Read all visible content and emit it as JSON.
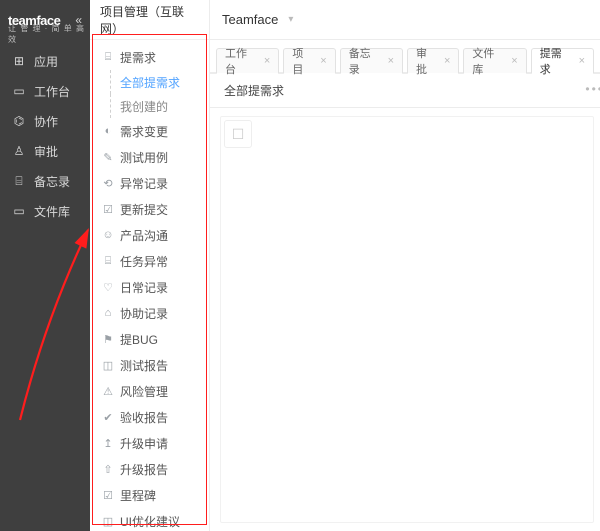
{
  "brand": {
    "name": "teamface",
    "tagline": "让 管 理 · 简 单 高 效",
    "collapse_glyph": "«"
  },
  "sidebar": {
    "items": [
      {
        "icon": "⊞",
        "label": "应用"
      },
      {
        "icon": "▭",
        "label": "工作台"
      },
      {
        "icon": "⌬",
        "label": "协作"
      },
      {
        "icon": "♙",
        "label": "审批"
      },
      {
        "icon": "⌸",
        "label": "备忘录"
      },
      {
        "icon": "▭",
        "label": "文件库"
      }
    ]
  },
  "panel": {
    "title": "项目管理（互联网）",
    "tree": {
      "root": {
        "icon": "⌸",
        "label": "提需求"
      },
      "subs": [
        {
          "label": "全部提需求",
          "active": true
        },
        {
          "label": "我创建的",
          "active": false
        }
      ]
    },
    "items": [
      {
        "icon": "◐",
        "label": "需求变更"
      },
      {
        "icon": "✎",
        "label": "测试用例"
      },
      {
        "icon": "⟲",
        "label": "异常记录"
      },
      {
        "icon": "☑",
        "label": "更新提交"
      },
      {
        "icon": "☺",
        "label": "产品沟通"
      },
      {
        "icon": "⌸",
        "label": "任务异常"
      },
      {
        "icon": "♡",
        "label": "日常记录"
      },
      {
        "icon": "⌂",
        "label": "协助记录"
      },
      {
        "icon": "⚑",
        "label": "提BUG"
      },
      {
        "icon": "◫",
        "label": "测试报告"
      },
      {
        "icon": "⚠",
        "label": "风险管理"
      },
      {
        "icon": "✔",
        "label": "验收报告"
      },
      {
        "icon": "↥",
        "label": "升级申请"
      },
      {
        "icon": "⇧",
        "label": "升级报告"
      },
      {
        "icon": "☑",
        "label": "里程碑"
      },
      {
        "icon": "◫",
        "label": "UI优化建议"
      }
    ]
  },
  "topbar": {
    "app_name": "Teamface",
    "dropdown_glyph": "▾"
  },
  "tabs": [
    {
      "label": "工作台",
      "closable": true,
      "active": false
    },
    {
      "label": "项目",
      "closable": true,
      "active": false
    },
    {
      "label": "备忘录",
      "closable": true,
      "active": false
    },
    {
      "label": "审批",
      "closable": true,
      "active": false
    },
    {
      "label": "文件库",
      "closable": true,
      "active": false
    },
    {
      "label": "提需求",
      "closable": true,
      "active": true
    }
  ],
  "subheader": {
    "title": "全部提需求",
    "more_glyph": "•••"
  },
  "content": {
    "placeholder_icon": "☐"
  },
  "colors": {
    "highlight_red": "#ff1d1d",
    "link_blue": "#52a3ff"
  }
}
